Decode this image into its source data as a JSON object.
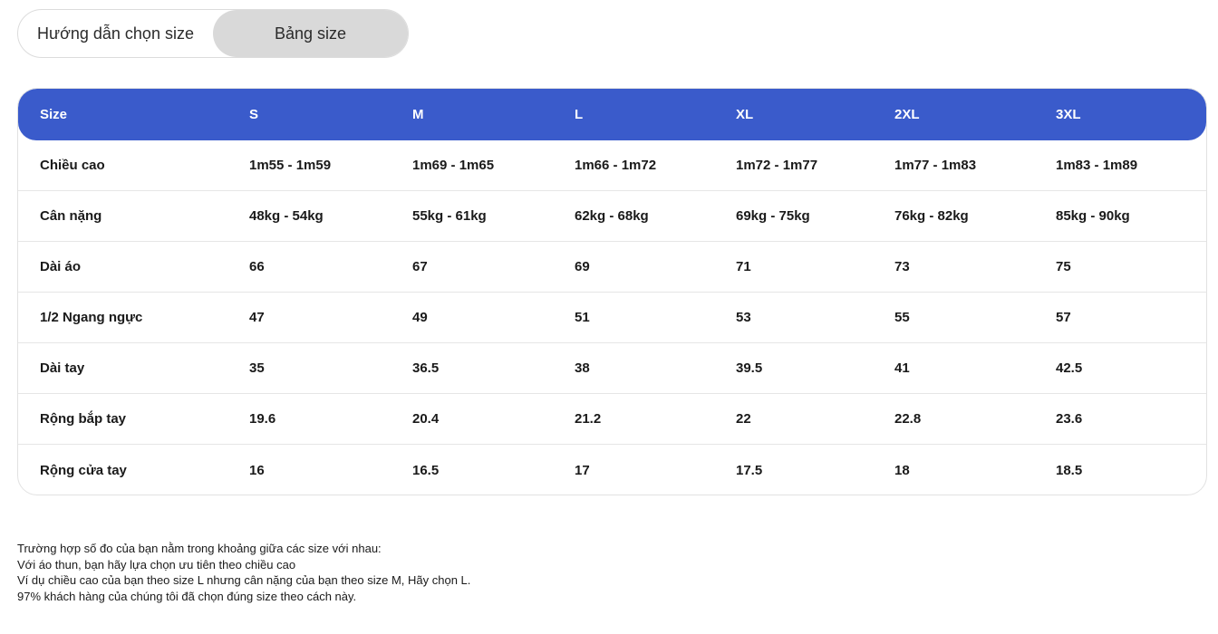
{
  "tabs": [
    {
      "label": "Hướng dẫn chọn size",
      "active": false
    },
    {
      "label": "Bảng size",
      "active": true
    }
  ],
  "colors": {
    "header_bg": "#3a5bcb",
    "active_tab_bg": "#d9d9d9"
  },
  "table": {
    "headers": [
      "Size",
      "S",
      "M",
      "L",
      "XL",
      "2XL",
      "3XL"
    ],
    "rows": [
      [
        "Chiều cao",
        "1m55 - 1m59",
        "1m69 - 1m65",
        "1m66 - 1m72",
        "1m72 - 1m77",
        "1m77 - 1m83",
        "1m83 - 1m89"
      ],
      [
        "Cân nặng",
        "48kg - 54kg",
        "55kg - 61kg",
        "62kg - 68kg",
        "69kg - 75kg",
        "76kg - 82kg",
        "85kg - 90kg"
      ],
      [
        "Dài áo",
        "66",
        "67",
        "69",
        "71",
        "73",
        "75"
      ],
      [
        "1/2 Ngang ngực",
        "47",
        "49",
        "51",
        "53",
        "55",
        "57"
      ],
      [
        "Dài tay",
        "35",
        "36.5",
        "38",
        "39.5",
        "41",
        "42.5"
      ],
      [
        "Rộng bắp tay",
        "19.6",
        "20.4",
        "21.2",
        "22",
        "22.8",
        "23.6"
      ],
      [
        "Rộng cửa tay",
        "16",
        "16.5",
        "17",
        "17.5",
        "18",
        "18.5"
      ]
    ]
  },
  "notes": [
    "Trường hợp số đo của bạn nằm trong khoảng giữa các size với nhau:",
    "Với áo thun, bạn hãy lựa chọn ưu tiên theo chiều cao",
    "Ví dụ chiều cao của bạn theo size L nhưng cân nặng của bạn theo size M, Hãy chọn L.",
    "97% khách hàng của chúng tôi đã chọn đúng size theo cách này."
  ]
}
